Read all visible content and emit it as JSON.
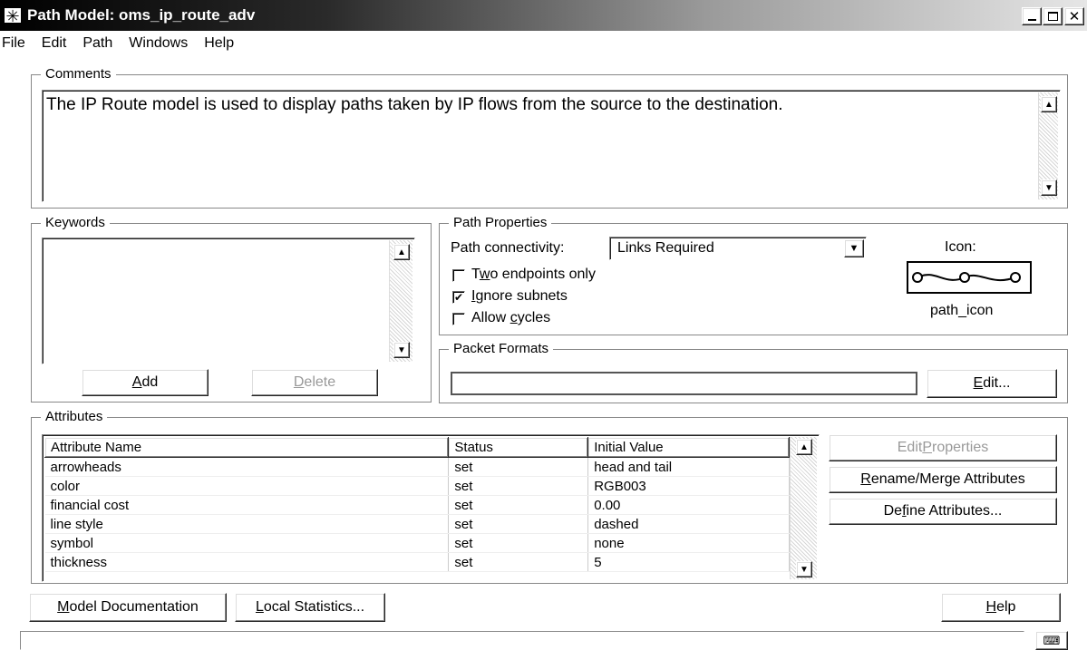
{
  "window": {
    "title": "Path Model: oms_ip_route_adv",
    "app_icon": "asterisk-icon",
    "controls": [
      "minimize",
      "maximize",
      "close"
    ]
  },
  "menu": {
    "items": [
      "File",
      "Edit",
      "Path",
      "Windows",
      "Help"
    ]
  },
  "comments": {
    "legend": "Comments",
    "text": "The IP Route model is used to display paths taken by IP flows from the source to the destination."
  },
  "keywords": {
    "legend": "Keywords",
    "items": [],
    "add": {
      "pre": "",
      "key": "A",
      "post": "dd"
    },
    "delete": {
      "pre": "",
      "key": "D",
      "post": "elete"
    }
  },
  "path_properties": {
    "legend": "Path Properties",
    "connectivity_label": "Path connectivity:",
    "connectivity_value": "Links Required",
    "checkboxes": [
      {
        "pre": "T",
        "key": "w",
        "post": "o endpoints only",
        "checked": false
      },
      {
        "pre": "",
        "key": "I",
        "post": "gnore subnets",
        "checked": true
      },
      {
        "pre": "Allow ",
        "key": "c",
        "post": "ycles",
        "checked": false
      }
    ],
    "icon_label": "Icon:",
    "icon_name": "path_icon"
  },
  "packet_formats": {
    "legend": "Packet Formats",
    "value": "",
    "edit": {
      "pre": "",
      "key": "E",
      "post": "dit..."
    }
  },
  "attributes": {
    "legend": "Attributes",
    "columns": [
      "Attribute Name",
      "Status",
      "Initial Value"
    ],
    "rows": [
      [
        "arrowheads",
        "set",
        "head and tail"
      ],
      [
        "color",
        "set",
        "RGB003"
      ],
      [
        "financial cost",
        "set",
        "0.00"
      ],
      [
        "line style",
        "set",
        "dashed"
      ],
      [
        "symbol",
        "set",
        "none"
      ],
      [
        "thickness",
        "set",
        "5"
      ]
    ],
    "edit_properties": {
      "pre": "Edit ",
      "key": "P",
      "post": "roperties"
    },
    "rename_merge": {
      "pre": "",
      "key": "R",
      "post": "ename/Merge Attributes"
    },
    "define": {
      "pre": "De",
      "key": "f",
      "post": "ine Attributes..."
    }
  },
  "footer": {
    "model_doc": {
      "pre": "",
      "key": "M",
      "post": "odel Documentation"
    },
    "local_stats": {
      "pre": "",
      "key": "L",
      "post": "ocal Statistics..."
    },
    "help": {
      "pre": "",
      "key": "H",
      "post": "elp"
    }
  },
  "status": {
    "text": "",
    "icon": "keyboard-icon"
  }
}
